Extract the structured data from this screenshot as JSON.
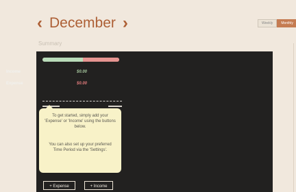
{
  "header": {
    "prev_icon": "chevron-left-icon",
    "prev_glyph": "‹",
    "month": "December",
    "next_icon": "chevron-right-icon",
    "next_glyph": "›"
  },
  "period_toggle": {
    "weekly_label": "Weekly",
    "monthly_label": "Monthly",
    "selected": "Monthly"
  },
  "summary_label": "Summary",
  "summary": {
    "income_fraction": 0.53,
    "income": {
      "label": "Income",
      "value": "$0.00",
      "color": "#a4c59c"
    },
    "expense": {
      "label": "Expense",
      "value": "$0.00",
      "color": "#e27b7c"
    }
  },
  "tooltip": {
    "paragraph1": "To get started, simply add your 'Expense' or 'Income' using the buttons below.",
    "paragraph2": "You can also set up your preferred Time Period via the 'Settings'."
  },
  "actions": {
    "add_expense_label": "+ Expense",
    "add_income_label": "+ Income"
  },
  "colors": {
    "accent": "#ad5f35",
    "panel_background": "#222120",
    "page_background": "#f1e8dd",
    "tooltip_background": "#f8f2c8"
  }
}
